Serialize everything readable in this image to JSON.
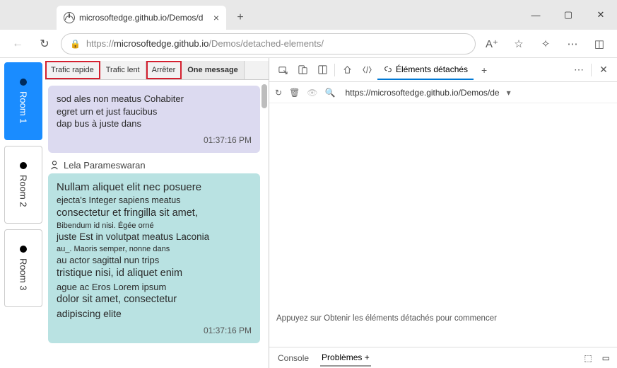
{
  "tab": {
    "title": "microsoftedge.github.io/Demos/d",
    "close": "×",
    "add": "+"
  },
  "win": {
    "min": "—",
    "max": "▢",
    "close": "✕"
  },
  "url": {
    "prefix": "https://",
    "host": "microsoftedge.github.io",
    "path": "/Demos/detached-elements/"
  },
  "rooms": [
    {
      "label": "Room 1",
      "active": true
    },
    {
      "label": "Room 2",
      "active": false
    },
    {
      "label": "Room 3",
      "active": false
    }
  ],
  "toolbar": {
    "fast": "Trafic rapide",
    "slow": "Trafic lent",
    "stop": "Arrêter",
    "one": "One message"
  },
  "msg1": {
    "line1": "sod ales non meatus    Cohabiter",
    "line2": "egret urn et just faucibus",
    "line3": "dap bus à juste dans",
    "time": "01:37:16 PM"
  },
  "author": "Lela Parameswaran",
  "msg2": {
    "l1": "Nullam aliquet elit nec posuere",
    "l2": "ejecta's Integer sapiens meatus",
    "l3": "consectetur et fringilla sit amet,",
    "l4": "Bibendum id nisi. Égée orné",
    "l5": "juste Est in volutpat meatus Laconia",
    "l6": "au_.  Maoris semper, nonne dans",
    "l7": "au actor sagittal nun trips",
    "l8": "tristique nisi, id aliquet enim",
    "l9": "ague ac Eros          Lorem ipsum",
    "l10": "dolor sit amet, consectetur",
    "l11": "adipiscing elite",
    "time": "01:37:16 PM"
  },
  "devtools": {
    "tab_detached": "Éléments détachés",
    "new_tab": "+",
    "more": "⋯",
    "url": "https://microsoftedge.github.io/Demos/de",
    "dropdown": "▾",
    "hint": "Appuyez sur Obtenir les éléments détachés pour commencer",
    "console": "Console",
    "problems": "Problèmes +"
  }
}
